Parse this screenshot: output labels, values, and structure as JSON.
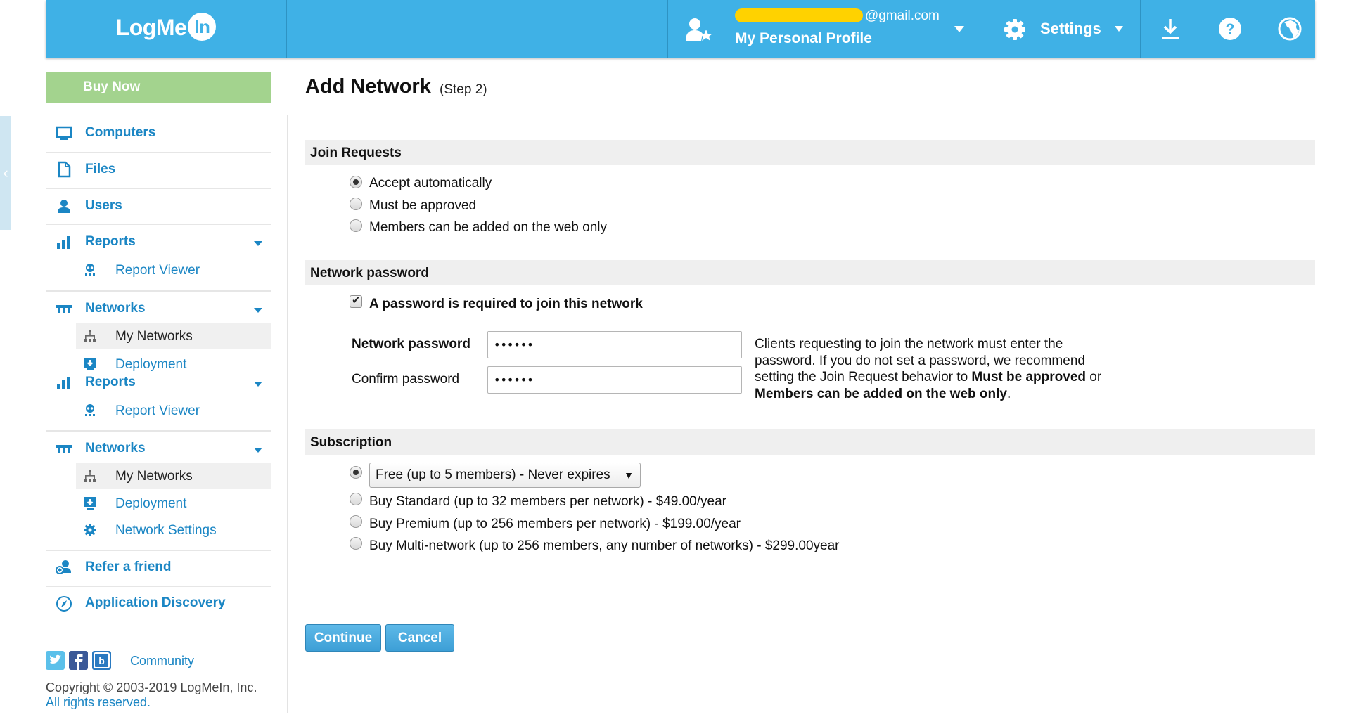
{
  "header": {
    "logo_text": "LogMe",
    "logo_in": "In",
    "email_suffix": "@gmail.com",
    "profile_name": "My Personal Profile",
    "settings_label": "Settings",
    "colors": {
      "header_bg": "#3fb1e6",
      "redaction": "#ffd200"
    },
    "icons": [
      "user-star-icon",
      "gear-icon",
      "download-icon",
      "help-icon",
      "globe-icon"
    ]
  },
  "sidebar": {
    "buy_now": "Buy Now",
    "items": {
      "computers": "Computers",
      "files": "Files",
      "users": "Users",
      "reports": "Reports",
      "report_viewer": "Report Viewer",
      "networks": "Networks",
      "my_networks": "My Networks",
      "deployment": "Deployment",
      "network_settings": "Network Settings",
      "refer_friend": "Refer a friend",
      "app_discovery": "Application Discovery"
    },
    "community": "Community",
    "copyright": "Copyright © 2003-2019 LogMeIn, Inc.",
    "rights": "All rights reserved.",
    "colors": {
      "link": "#1b86c4",
      "buy_now_bg": "#a3d38e"
    }
  },
  "main": {
    "title": "Add Network",
    "step": "(Step 2)",
    "join_requests": {
      "heading": "Join Requests",
      "options": [
        "Accept automatically",
        "Must be approved",
        "Members can be added on the web only"
      ],
      "selected": 0
    },
    "password": {
      "heading": "Network password",
      "required_label": "A password is required to join this network",
      "required_checked": true,
      "password_label": "Network password",
      "password_value": "••••••",
      "confirm_label": "Confirm password",
      "confirm_value": "••••••",
      "help_part1": "Clients requesting to join the network must enter the password. If you do not set a password, we recommend setting the Join Request behavior to ",
      "help_bold1": "Must be approved",
      "help_part2": " or ",
      "help_bold2": "Members can be added on the web only",
      "help_part3": "."
    },
    "subscription": {
      "heading": "Subscription",
      "free_selected_value": "Free (up to 5 members) - Never expires",
      "options": [
        "Buy Standard (up to 32 members per network) - $49.00/year",
        "Buy Premium (up to 256 members per network) - $199.00/year",
        "Buy Multi-network (up to 256 members, any number of networks) - $299.00year"
      ]
    },
    "continue_label": "Continue",
    "cancel_label": "Cancel"
  }
}
